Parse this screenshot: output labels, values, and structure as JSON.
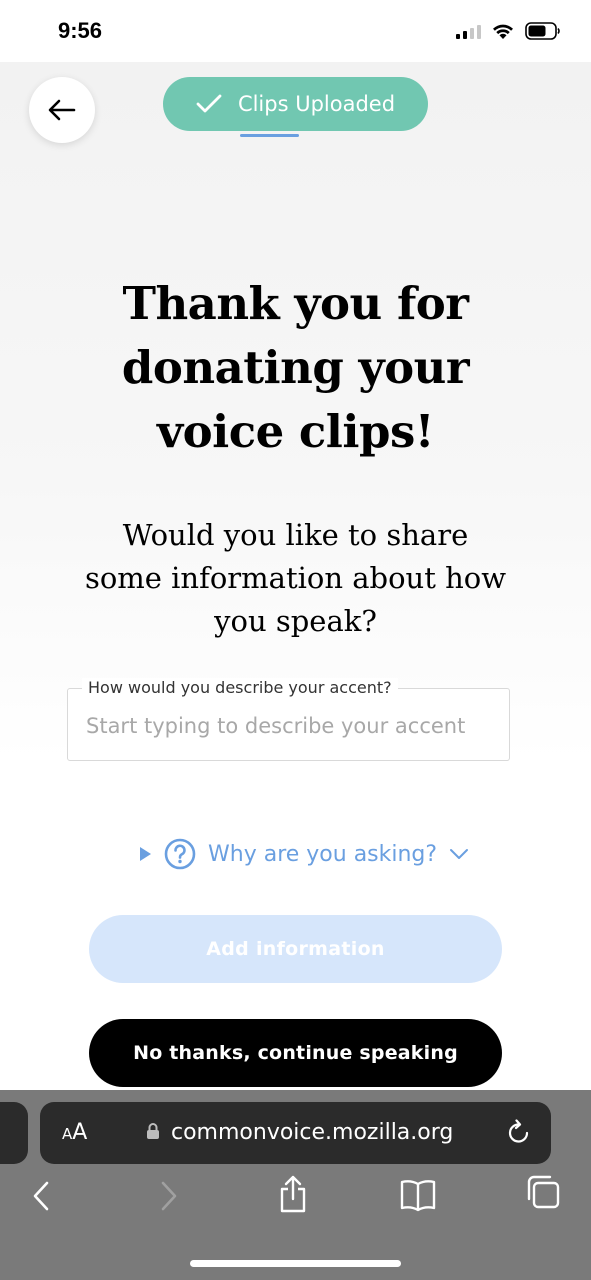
{
  "status_bar": {
    "time": "9:56"
  },
  "header": {
    "upload_status": "Clips Uploaded"
  },
  "main": {
    "headline": "Thank you for donating your voice clips!",
    "subheadline": "Would you like to share some information about how you speak?",
    "accent_field": {
      "label": "How would you describe your accent?",
      "placeholder": "Start typing to describe your accent",
      "value": ""
    },
    "why_link": "Why are you asking?",
    "add_button": "Add information",
    "skip_button": "No thanks, continue speaking"
  },
  "browser": {
    "text_size_label": "AA",
    "url": "commonvoice.mozilla.org"
  },
  "colors": {
    "accent_green": "#71c7b1",
    "link_blue": "#6a9fe0",
    "disabled_button": "#d6e6fb",
    "primary_button": "#000000"
  },
  "icons": [
    "back-arrow-icon",
    "checkmark-icon",
    "play-triangle-icon",
    "question-circle-icon",
    "chevron-down-icon",
    "lock-icon",
    "reload-icon",
    "back-chevron-icon",
    "forward-chevron-icon",
    "share-icon",
    "bookmarks-icon",
    "tabs-icon"
  ]
}
